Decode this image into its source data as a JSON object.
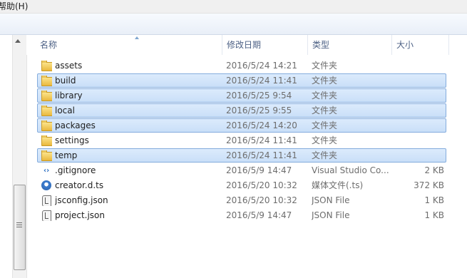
{
  "menu": {
    "help": "帮助(H)"
  },
  "columns": {
    "name": "名称",
    "date": "修改日期",
    "type": "类型",
    "size": "大小"
  },
  "files": [
    {
      "name": "assets",
      "date": "2016/5/24 14:21",
      "type": "文件夹",
      "size": "",
      "icon": "folder-icon",
      "selected": false
    },
    {
      "name": "build",
      "date": "2016/5/24 11:41",
      "type": "文件夹",
      "size": "",
      "icon": "folder-icon",
      "selected": true
    },
    {
      "name": "library",
      "date": "2016/5/25 9:54",
      "type": "文件夹",
      "size": "",
      "icon": "folder-icon",
      "selected": true
    },
    {
      "name": "local",
      "date": "2016/5/25 9:55",
      "type": "文件夹",
      "size": "",
      "icon": "folder-icon",
      "selected": true
    },
    {
      "name": "packages",
      "date": "2016/5/24 14:20",
      "type": "文件夹",
      "size": "",
      "icon": "folder-icon",
      "selected": true
    },
    {
      "name": "settings",
      "date": "2016/5/24 11:41",
      "type": "文件夹",
      "size": "",
      "icon": "folder-icon",
      "selected": false
    },
    {
      "name": "temp",
      "date": "2016/5/24 11:41",
      "type": "文件夹",
      "size": "",
      "icon": "folder-icon",
      "selected": true
    },
    {
      "name": ".gitignore",
      "date": "2016/5/9 14:47",
      "type": "Visual Studio Co...",
      "size": "2 KB",
      "icon": "visual-studio-file-icon",
      "selected": false
    },
    {
      "name": "creator.d.ts",
      "date": "2016/5/20 10:32",
      "type": "媒体文件(.ts)",
      "size": "372 KB",
      "icon": "media-file-icon",
      "selected": false
    },
    {
      "name": "jsconfig.json",
      "date": "2016/5/20 10:32",
      "type": "JSON File",
      "size": "1 KB",
      "icon": "json-script-icon",
      "selected": false
    },
    {
      "name": "project.json",
      "date": "2016/5/9 14:47",
      "type": "JSON File",
      "size": "1 KB",
      "icon": "json-script-icon",
      "selected": false
    }
  ],
  "colors": {
    "selection": "#c9dff8",
    "selection_border": "#84acdd",
    "header_text": "#4d6185"
  }
}
